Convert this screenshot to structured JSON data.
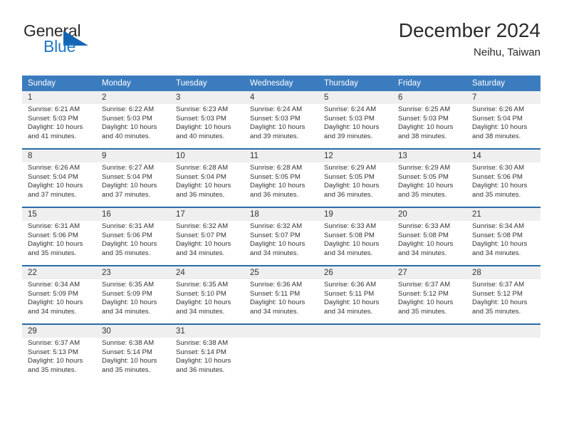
{
  "brand": {
    "name_part1": "General",
    "name_part2": "Blue",
    "triangle_color": "#1565b5",
    "blue_color": "#1f77c4"
  },
  "header": {
    "month_title": "December 2024",
    "location": "Neihu, Taiwan",
    "header_bg_color": "#3b7cbf",
    "daynum_bg_color": "#efefef",
    "separator_color": "#2a6ca8"
  },
  "weekday_headers": [
    "Sunday",
    "Monday",
    "Tuesday",
    "Wednesday",
    "Thursday",
    "Friday",
    "Saturday"
  ],
  "weeks": [
    {
      "days": [
        {
          "num": "1",
          "sunrise": "Sunrise: 6:21 AM",
          "sunset": "Sunset: 5:03 PM",
          "daylight1": "Daylight: 10 hours",
          "daylight2": "and 41 minutes."
        },
        {
          "num": "2",
          "sunrise": "Sunrise: 6:22 AM",
          "sunset": "Sunset: 5:03 PM",
          "daylight1": "Daylight: 10 hours",
          "daylight2": "and 40 minutes."
        },
        {
          "num": "3",
          "sunrise": "Sunrise: 6:23 AM",
          "sunset": "Sunset: 5:03 PM",
          "daylight1": "Daylight: 10 hours",
          "daylight2": "and 40 minutes."
        },
        {
          "num": "4",
          "sunrise": "Sunrise: 6:24 AM",
          "sunset": "Sunset: 5:03 PM",
          "daylight1": "Daylight: 10 hours",
          "daylight2": "and 39 minutes."
        },
        {
          "num": "5",
          "sunrise": "Sunrise: 6:24 AM",
          "sunset": "Sunset: 5:03 PM",
          "daylight1": "Daylight: 10 hours",
          "daylight2": "and 39 minutes."
        },
        {
          "num": "6",
          "sunrise": "Sunrise: 6:25 AM",
          "sunset": "Sunset: 5:03 PM",
          "daylight1": "Daylight: 10 hours",
          "daylight2": "and 38 minutes."
        },
        {
          "num": "7",
          "sunrise": "Sunrise: 6:26 AM",
          "sunset": "Sunset: 5:04 PM",
          "daylight1": "Daylight: 10 hours",
          "daylight2": "and 38 minutes."
        }
      ]
    },
    {
      "days": [
        {
          "num": "8",
          "sunrise": "Sunrise: 6:26 AM",
          "sunset": "Sunset: 5:04 PM",
          "daylight1": "Daylight: 10 hours",
          "daylight2": "and 37 minutes."
        },
        {
          "num": "9",
          "sunrise": "Sunrise: 6:27 AM",
          "sunset": "Sunset: 5:04 PM",
          "daylight1": "Daylight: 10 hours",
          "daylight2": "and 37 minutes."
        },
        {
          "num": "10",
          "sunrise": "Sunrise: 6:28 AM",
          "sunset": "Sunset: 5:04 PM",
          "daylight1": "Daylight: 10 hours",
          "daylight2": "and 36 minutes."
        },
        {
          "num": "11",
          "sunrise": "Sunrise: 6:28 AM",
          "sunset": "Sunset: 5:05 PM",
          "daylight1": "Daylight: 10 hours",
          "daylight2": "and 36 minutes."
        },
        {
          "num": "12",
          "sunrise": "Sunrise: 6:29 AM",
          "sunset": "Sunset: 5:05 PM",
          "daylight1": "Daylight: 10 hours",
          "daylight2": "and 36 minutes."
        },
        {
          "num": "13",
          "sunrise": "Sunrise: 6:29 AM",
          "sunset": "Sunset: 5:05 PM",
          "daylight1": "Daylight: 10 hours",
          "daylight2": "and 35 minutes."
        },
        {
          "num": "14",
          "sunrise": "Sunrise: 6:30 AM",
          "sunset": "Sunset: 5:06 PM",
          "daylight1": "Daylight: 10 hours",
          "daylight2": "and 35 minutes."
        }
      ]
    },
    {
      "days": [
        {
          "num": "15",
          "sunrise": "Sunrise: 6:31 AM",
          "sunset": "Sunset: 5:06 PM",
          "daylight1": "Daylight: 10 hours",
          "daylight2": "and 35 minutes."
        },
        {
          "num": "16",
          "sunrise": "Sunrise: 6:31 AM",
          "sunset": "Sunset: 5:06 PM",
          "daylight1": "Daylight: 10 hours",
          "daylight2": "and 35 minutes."
        },
        {
          "num": "17",
          "sunrise": "Sunrise: 6:32 AM",
          "sunset": "Sunset: 5:07 PM",
          "daylight1": "Daylight: 10 hours",
          "daylight2": "and 34 minutes."
        },
        {
          "num": "18",
          "sunrise": "Sunrise: 6:32 AM",
          "sunset": "Sunset: 5:07 PM",
          "daylight1": "Daylight: 10 hours",
          "daylight2": "and 34 minutes."
        },
        {
          "num": "19",
          "sunrise": "Sunrise: 6:33 AM",
          "sunset": "Sunset: 5:08 PM",
          "daylight1": "Daylight: 10 hours",
          "daylight2": "and 34 minutes."
        },
        {
          "num": "20",
          "sunrise": "Sunrise: 6:33 AM",
          "sunset": "Sunset: 5:08 PM",
          "daylight1": "Daylight: 10 hours",
          "daylight2": "and 34 minutes."
        },
        {
          "num": "21",
          "sunrise": "Sunrise: 6:34 AM",
          "sunset": "Sunset: 5:08 PM",
          "daylight1": "Daylight: 10 hours",
          "daylight2": "and 34 minutes."
        }
      ]
    },
    {
      "days": [
        {
          "num": "22",
          "sunrise": "Sunrise: 6:34 AM",
          "sunset": "Sunset: 5:09 PM",
          "daylight1": "Daylight: 10 hours",
          "daylight2": "and 34 minutes."
        },
        {
          "num": "23",
          "sunrise": "Sunrise: 6:35 AM",
          "sunset": "Sunset: 5:09 PM",
          "daylight1": "Daylight: 10 hours",
          "daylight2": "and 34 minutes."
        },
        {
          "num": "24",
          "sunrise": "Sunrise: 6:35 AM",
          "sunset": "Sunset: 5:10 PM",
          "daylight1": "Daylight: 10 hours",
          "daylight2": "and 34 minutes."
        },
        {
          "num": "25",
          "sunrise": "Sunrise: 6:36 AM",
          "sunset": "Sunset: 5:11 PM",
          "daylight1": "Daylight: 10 hours",
          "daylight2": "and 34 minutes."
        },
        {
          "num": "26",
          "sunrise": "Sunrise: 6:36 AM",
          "sunset": "Sunset: 5:11 PM",
          "daylight1": "Daylight: 10 hours",
          "daylight2": "and 34 minutes."
        },
        {
          "num": "27",
          "sunrise": "Sunrise: 6:37 AM",
          "sunset": "Sunset: 5:12 PM",
          "daylight1": "Daylight: 10 hours",
          "daylight2": "and 35 minutes."
        },
        {
          "num": "28",
          "sunrise": "Sunrise: 6:37 AM",
          "sunset": "Sunset: 5:12 PM",
          "daylight1": "Daylight: 10 hours",
          "daylight2": "and 35 minutes."
        }
      ]
    },
    {
      "days": [
        {
          "num": "29",
          "sunrise": "Sunrise: 6:37 AM",
          "sunset": "Sunset: 5:13 PM",
          "daylight1": "Daylight: 10 hours",
          "daylight2": "and 35 minutes."
        },
        {
          "num": "30",
          "sunrise": "Sunrise: 6:38 AM",
          "sunset": "Sunset: 5:14 PM",
          "daylight1": "Daylight: 10 hours",
          "daylight2": "and 35 minutes."
        },
        {
          "num": "31",
          "sunrise": "Sunrise: 6:38 AM",
          "sunset": "Sunset: 5:14 PM",
          "daylight1": "Daylight: 10 hours",
          "daylight2": "and 36 minutes."
        },
        {
          "num": "",
          "sunrise": "",
          "sunset": "",
          "daylight1": "",
          "daylight2": ""
        },
        {
          "num": "",
          "sunrise": "",
          "sunset": "",
          "daylight1": "",
          "daylight2": ""
        },
        {
          "num": "",
          "sunrise": "",
          "sunset": "",
          "daylight1": "",
          "daylight2": ""
        },
        {
          "num": "",
          "sunrise": "",
          "sunset": "",
          "daylight1": "",
          "daylight2": ""
        }
      ]
    }
  ]
}
